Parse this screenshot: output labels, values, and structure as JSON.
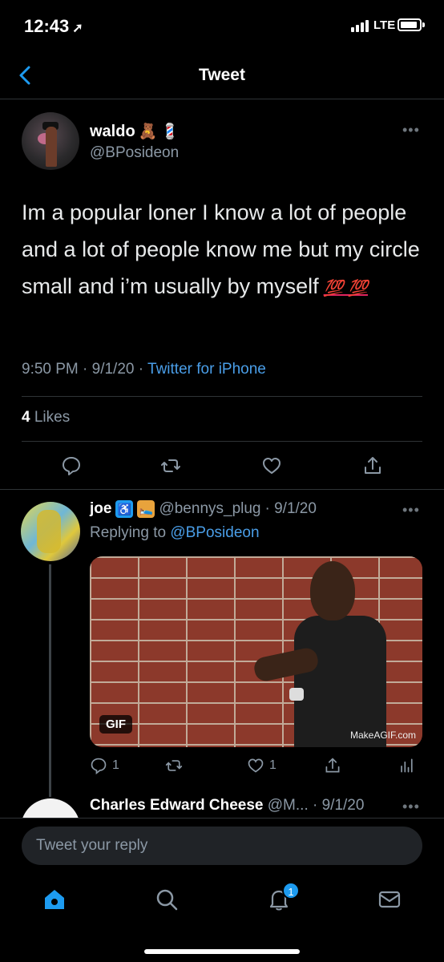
{
  "status": {
    "time": "12:43",
    "location_glyph": "➚",
    "network": "LTE"
  },
  "nav": {
    "title": "Tweet"
  },
  "tweet": {
    "author_name": "waldo",
    "author_emojis": [
      "🧸",
      "💈"
    ],
    "handle": "@BPosideon",
    "text": "Im a popular loner I know a lot of people and a lot of people know me but my circle small and i’m usually by myself",
    "text_emoji": "💯 💯",
    "time": "9:50 PM · 9/1/20 · ",
    "source": "Twitter for iPhone",
    "likes_count": "4",
    "likes_label": "Likes"
  },
  "reply": {
    "name": "joe",
    "badges": [
      "♿",
      "🛌"
    ],
    "handle": "@bennys_plug",
    "date": "· 9/1/20",
    "replying_prefix": "Replying to ",
    "replying_handle": "@BPosideon",
    "gif_label": "GIF",
    "gif_watermark": "MakeAGIF.com",
    "reply_count": "1",
    "like_count": "1"
  },
  "reply2": {
    "name": "Charles Edward Cheese",
    "handle": "@M...",
    "date": "· 9/1/20"
  },
  "compose": {
    "placeholder": "Tweet your reply"
  },
  "tabbar": {
    "notification_count": "1"
  },
  "colors": {
    "accent": "#1d9bf0",
    "link": "#4a9ee8",
    "background": "#000000",
    "secondary_text": "#8b98a5"
  },
  "icons": [
    "chevron-left-icon",
    "more-icon",
    "reply-icon",
    "retweet-icon",
    "like-icon",
    "share-icon",
    "analytics-icon",
    "home-icon",
    "search-icon",
    "notifications-icon",
    "messages-icon"
  ]
}
